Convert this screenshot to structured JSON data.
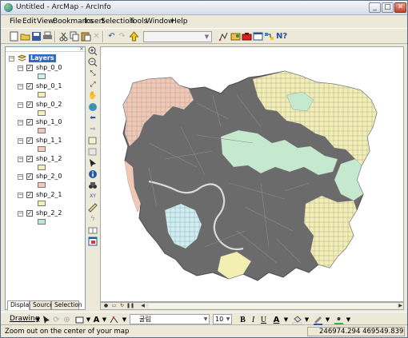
{
  "window": {
    "title": "Untitled - ArcMap - ArcInfo",
    "min": "_",
    "max": "□",
    "close": "✕"
  },
  "menu": [
    "File",
    "Edit",
    "View",
    "Bookmarks",
    "Insert",
    "Selection",
    "Tools",
    "Window",
    "Help"
  ],
  "toc": {
    "root_label": "Layers",
    "expander": "−",
    "check": "✓",
    "layers": [
      {
        "name": "shp_0_0",
        "color": "#cfeff2"
      },
      {
        "name": "shp_0_1",
        "color": "#f3f0b2"
      },
      {
        "name": "shp_0_2",
        "color": "#f6f1b4"
      },
      {
        "name": "shp_1_0",
        "color": "#f2c9b8"
      },
      {
        "name": "shp_1_1",
        "color": "#f1ccbb"
      },
      {
        "name": "shp_1_2",
        "color": "#f4efb6"
      },
      {
        "name": "shp_2_0",
        "color": "#f2c8b8"
      },
      {
        "name": "shp_2_1",
        "color": "#f3eeb6"
      },
      {
        "name": "shp_2_2",
        "color": "#bfe6cf"
      }
    ],
    "tabs": [
      "Display",
      "Source",
      "Selection"
    ]
  },
  "drawing": {
    "label": "Drawing",
    "font_name": "굴림",
    "font_size": "10"
  },
  "status": {
    "message": "Zoom out on the center of your map",
    "coordinates": "246974.294  469549.839 Unl"
  },
  "map_colors": {
    "dense_urban": "#6b6b6b",
    "peach": "#f2c8b5",
    "yellow": "#f3efb3",
    "green": "#c5e9cf",
    "cyan": "#cdeff4"
  }
}
